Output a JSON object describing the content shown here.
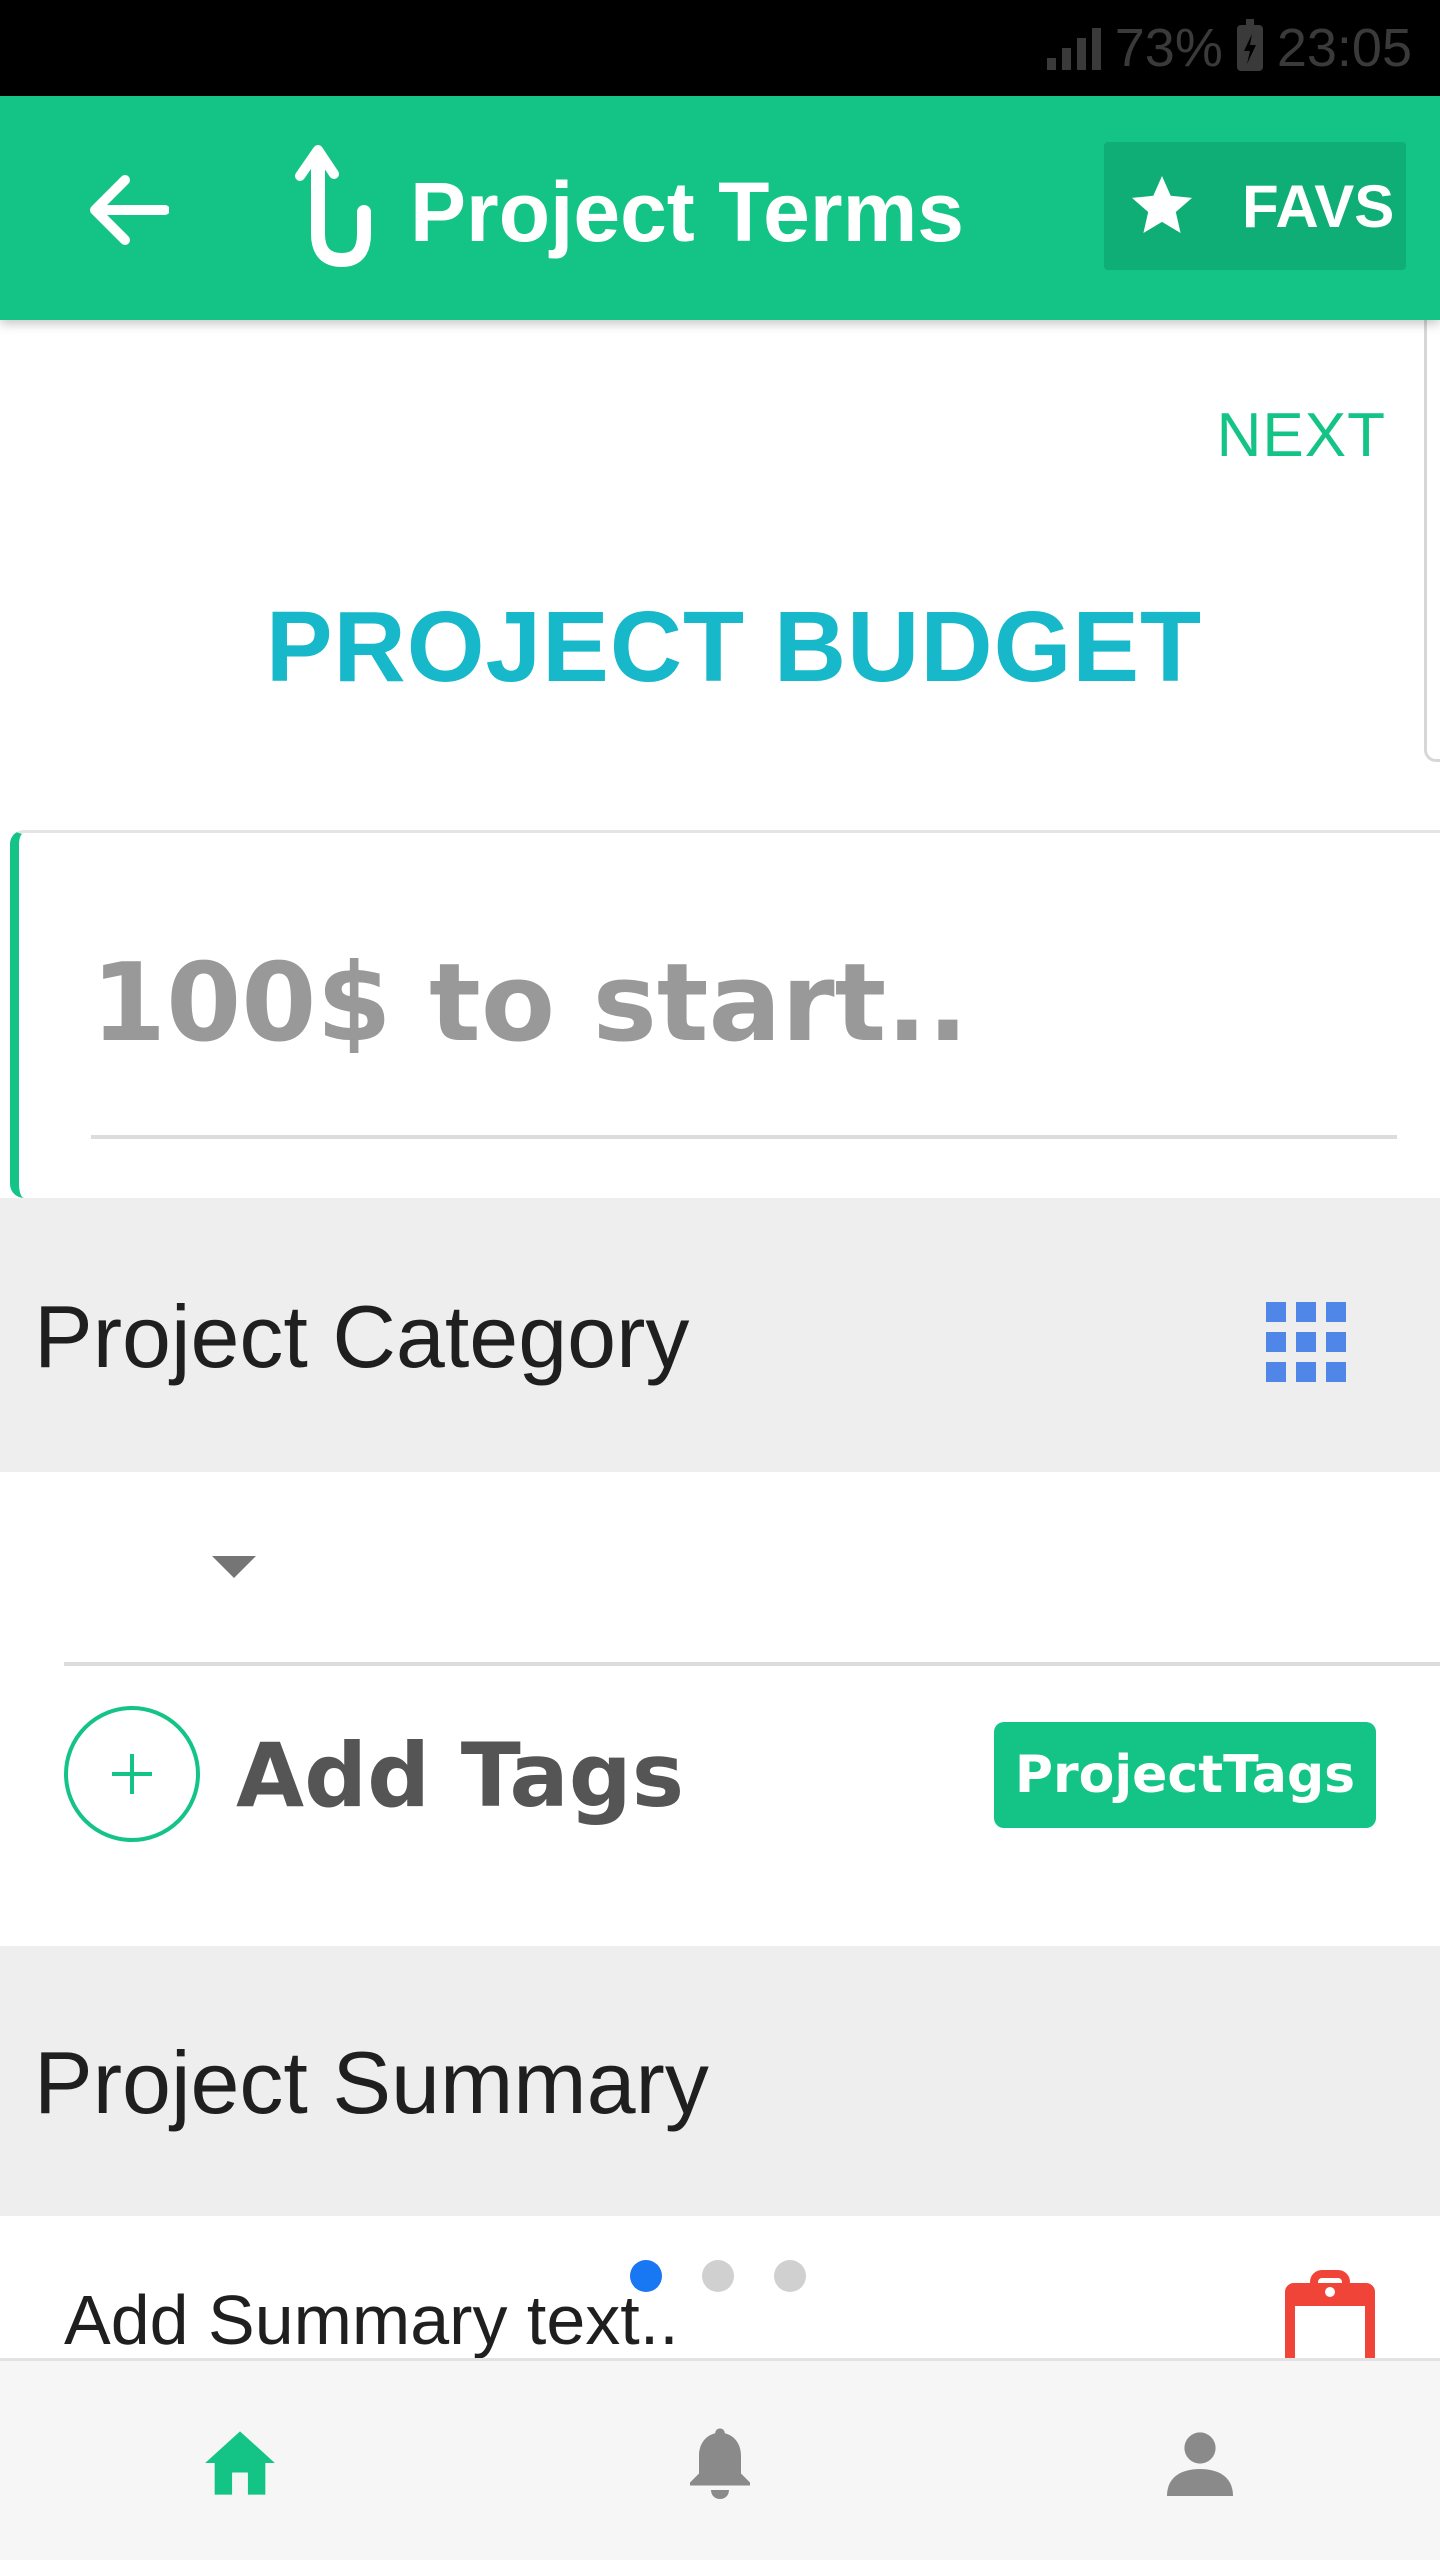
{
  "status_bar": {
    "battery_percent": "73%",
    "time": "23:05",
    "icons": [
      "signal-icon",
      "battery-charging-icon"
    ]
  },
  "app_bar": {
    "title": "Project Terms",
    "favs_label": "FAVS",
    "icons": [
      "back-arrow-icon",
      "app-logo-icon",
      "star-icon"
    ]
  },
  "budget": {
    "next_label": "NEXT",
    "title": "PROJECT BUDGET",
    "placeholder": "100$ to start..",
    "value": ""
  },
  "category": {
    "title": "Project Category",
    "selected_value": "",
    "icons": [
      "grid-icon",
      "dropdown-arrow-icon"
    ]
  },
  "tags": {
    "label": "Add Tags",
    "chip_label": "ProjectTags",
    "icons": [
      "plus-circle-icon"
    ]
  },
  "summary": {
    "title": "Project Summary",
    "placeholder_text": "Add Summary text..",
    "pager": {
      "pages": 3,
      "active_index": 0
    },
    "icons": [
      "clipboard-icon"
    ]
  },
  "bottom_nav": {
    "items": [
      {
        "icon": "home-icon",
        "active": true
      },
      {
        "icon": "bell-icon",
        "active": false
      },
      {
        "icon": "person-icon",
        "active": false
      }
    ]
  },
  "colors": {
    "primary_green": "#14c487",
    "title_cyan": "#16b8c9",
    "grid_blue": "#4f86e8",
    "pager_active": "#1877f2",
    "clipboard_red": "#f04438"
  }
}
